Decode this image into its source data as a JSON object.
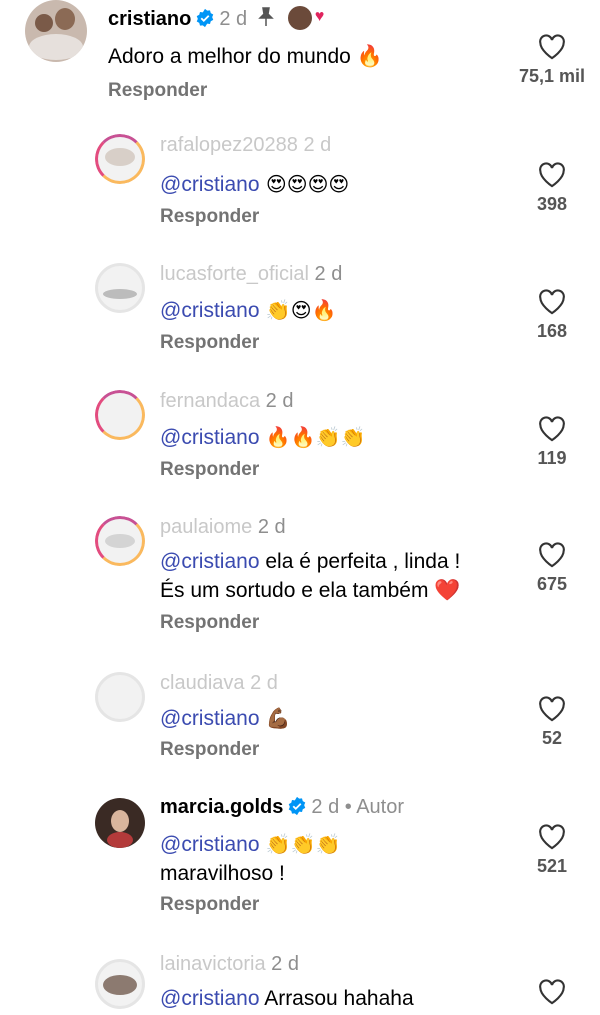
{
  "top_comment": {
    "username": "cristiano",
    "time": "2 d",
    "text": "Adoro a melhor do mundo 🔥",
    "reply_label": "Responder",
    "likes": "75,1 mil"
  },
  "replies": [
    {
      "username": "rafalopez20288",
      "time": "2 d",
      "mention": "@cristiano",
      "text": " 😍😍😍😍",
      "reply_label": "Responder",
      "likes": "398"
    },
    {
      "username": "lucasforte_oficial",
      "time": "2 d",
      "mention": "@cristiano",
      "text": " 👏😍🔥",
      "reply_label": "Responder",
      "likes": "168"
    },
    {
      "username": "fernandaca",
      "time": "2 d",
      "mention": "@cristiano",
      "text": " 🔥🔥👏👏",
      "reply_label": "Responder",
      "likes": "119"
    },
    {
      "username": "paulaiome",
      "time": "2 d",
      "mention": "@cristiano",
      "text": " ela é perfeita , linda !",
      "text2": "És um sortudo e ela também ❤️",
      "reply_label": "Responder",
      "likes": "675"
    },
    {
      "username": "claudiava",
      "time": "2 d",
      "mention": "@cristiano",
      "text": " 💪🏾",
      "reply_label": "Responder",
      "likes": "52"
    },
    {
      "username": "marcia.golds",
      "time": "2 d",
      "author_tag": "• Autor",
      "mention": "@cristiano",
      "text": " 👏👏👏",
      "text2": "maravilhoso !",
      "reply_label": "Responder",
      "likes": "521"
    },
    {
      "username": "lainavictoria",
      "time": "2 d",
      "mention": "@cristiano",
      "text": " Arrasou hahaha",
      "likes": ""
    }
  ],
  "colors": {
    "mention": "#3b4bb0",
    "verified": "#0095f6",
    "story_ring": "#c13584"
  },
  "icons": [
    "verified-badge-icon",
    "pin-icon",
    "heart-outline-icon"
  ]
}
